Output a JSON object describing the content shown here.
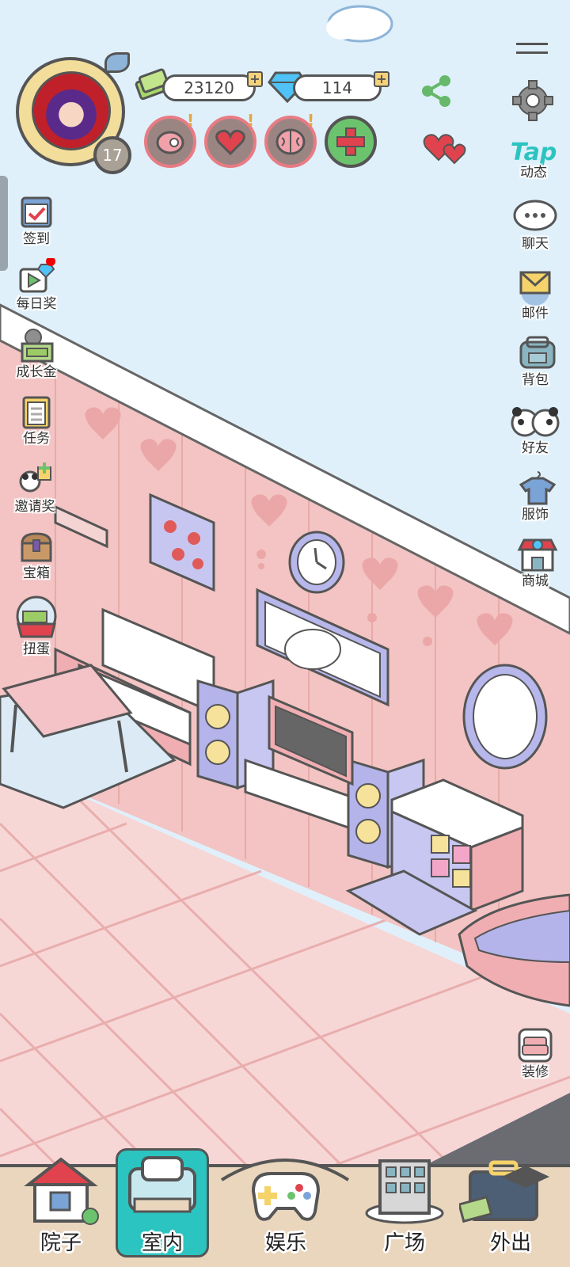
{
  "currency": {
    "coins": "23120",
    "diamonds": "114"
  },
  "player": {
    "level": "17"
  },
  "top_right": {
    "tap_logo": "Tap",
    "tap_label": "动态"
  },
  "left_menu": [
    {
      "label": "签到",
      "icon": "calendar-check-icon"
    },
    {
      "label": "每日奖",
      "icon": "video-reward-icon"
    },
    {
      "label": "成长金",
      "icon": "growth-fund-icon"
    },
    {
      "label": "任务",
      "icon": "task-list-icon"
    },
    {
      "label": "邀请奖",
      "icon": "invite-gift-icon"
    },
    {
      "label": "宝箱",
      "icon": "treasure-chest-icon"
    },
    {
      "label": "扭蛋",
      "icon": "gacha-machine-icon"
    }
  ],
  "right_menu": [
    {
      "label": "聊天",
      "icon": "chat-bubble-icon"
    },
    {
      "label": "邮件",
      "icon": "mail-icon"
    },
    {
      "label": "背包",
      "icon": "backpack-icon"
    },
    {
      "label": "好友",
      "icon": "friends-icon"
    },
    {
      "label": "服饰",
      "icon": "clothing-icon"
    },
    {
      "label": "商城",
      "icon": "shop-icon"
    }
  ],
  "decorate": {
    "label": "装修"
  },
  "bottom_nav": [
    {
      "label": "院子",
      "icon": "house-icon"
    },
    {
      "label": "室内",
      "icon": "indoor-icon",
      "active": true
    },
    {
      "label": "娱乐",
      "icon": "gamepad-icon"
    },
    {
      "label": "广场",
      "icon": "building-icon"
    },
    {
      "label": "外出",
      "icon": "suitcase-icon"
    }
  ],
  "colors": {
    "accent_teal": "#2bc4c0",
    "wall_pink": "#f2c6c6",
    "floor_pink": "#f7d3d3",
    "sky": "#dff0fb"
  }
}
